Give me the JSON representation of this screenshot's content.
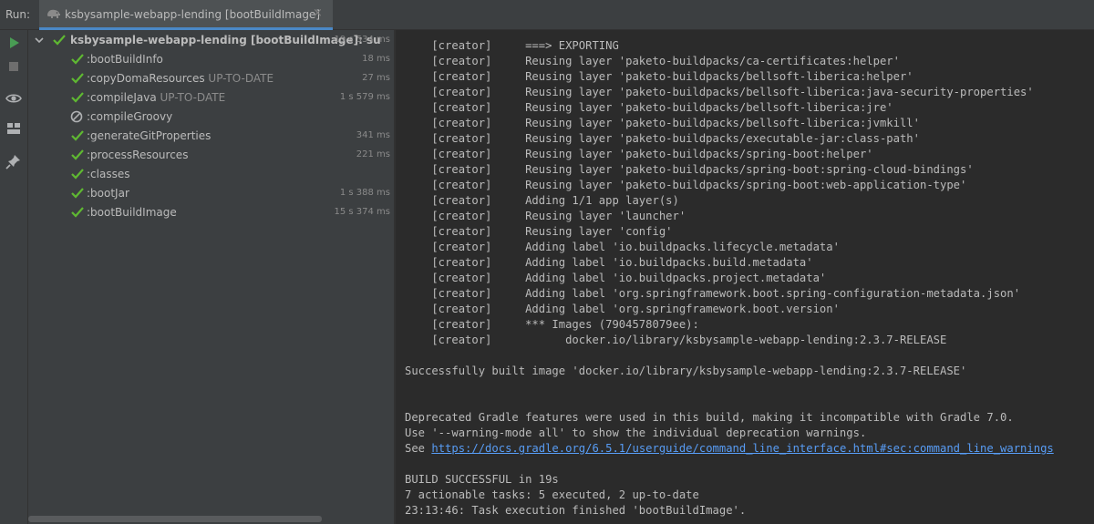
{
  "run_label": "Run:",
  "tab": {
    "title": "ksbysample-webapp-lending [bootBuildImage]",
    "close": "×",
    "icon": "gradle-elephant-icon"
  },
  "toolstrip": [
    {
      "name": "rerun-icon",
      "color": "#499c54"
    },
    {
      "name": "stop-icon",
      "color": "#6e6e6e"
    },
    {
      "name": "eye-icon",
      "color": "#afb1b3"
    },
    {
      "name": "layout-icon",
      "color": "#afb1b3"
    },
    {
      "name": "pin-icon",
      "color": "#afb1b3"
    }
  ],
  "tree": {
    "root": {
      "label": "ksbysample-webapp-lending [bootBuildImage]: su",
      "duration": "19 s 534 ms"
    },
    "tasks": [
      {
        "label": ":bootBuildInfo",
        "suffix": "",
        "duration": "18 ms",
        "status": "success"
      },
      {
        "label": ":copyDomaResources",
        "suffix": " UP-TO-DATE",
        "duration": "27 ms",
        "status": "success"
      },
      {
        "label": ":compileJava",
        "suffix": " UP-TO-DATE",
        "duration": "1 s 579 ms",
        "status": "success"
      },
      {
        "label": ":compileGroovy",
        "suffix": "",
        "duration": "",
        "status": "skipped"
      },
      {
        "label": ":generateGitProperties",
        "suffix": "",
        "duration": "341 ms",
        "status": "success"
      },
      {
        "label": ":processResources",
        "suffix": "",
        "duration": "221 ms",
        "status": "success"
      },
      {
        "label": ":classes",
        "suffix": "",
        "duration": "",
        "status": "success"
      },
      {
        "label": ":bootJar",
        "suffix": "",
        "duration": "1 s 388 ms",
        "status": "success"
      },
      {
        "label": ":bootBuildImage",
        "suffix": "",
        "duration": "15 s 374 ms",
        "status": "success"
      }
    ]
  },
  "colors": {
    "success": "#5fb832",
    "skipped": "#afb1b3",
    "link": "#589df6"
  },
  "console": {
    "lines": [
      "    [creator]     ===> EXPORTING",
      "    [creator]     Reusing layer 'paketo-buildpacks/ca-certificates:helper'",
      "    [creator]     Reusing layer 'paketo-buildpacks/bellsoft-liberica:helper'",
      "    [creator]     Reusing layer 'paketo-buildpacks/bellsoft-liberica:java-security-properties'",
      "    [creator]     Reusing layer 'paketo-buildpacks/bellsoft-liberica:jre'",
      "    [creator]     Reusing layer 'paketo-buildpacks/bellsoft-liberica:jvmkill'",
      "    [creator]     Reusing layer 'paketo-buildpacks/executable-jar:class-path'",
      "    [creator]     Reusing layer 'paketo-buildpacks/spring-boot:helper'",
      "    [creator]     Reusing layer 'paketo-buildpacks/spring-boot:spring-cloud-bindings'",
      "    [creator]     Reusing layer 'paketo-buildpacks/spring-boot:web-application-type'",
      "    [creator]     Adding 1/1 app layer(s)",
      "    [creator]     Reusing layer 'launcher'",
      "    [creator]     Reusing layer 'config'",
      "    [creator]     Adding label 'io.buildpacks.lifecycle.metadata'",
      "    [creator]     Adding label 'io.buildpacks.build.metadata'",
      "    [creator]     Adding label 'io.buildpacks.project.metadata'",
      "    [creator]     Adding label 'org.springframework.boot.spring-configuration-metadata.json'",
      "    [creator]     Adding label 'org.springframework.boot.version'",
      "    [creator]     *** Images (7904578079ee):",
      "    [creator]           docker.io/library/ksbysample-webapp-lending:2.3.7-RELEASE",
      "",
      "Successfully built image 'docker.io/library/ksbysample-webapp-lending:2.3.7-RELEASE'",
      "",
      "",
      "Deprecated Gradle features were used in this build, making it incompatible with Gradle 7.0.",
      "Use '--warning-mode all' to show the individual deprecation warnings.",
      "",
      "",
      "BUILD SUCCESSFUL in 19s",
      "7 actionable tasks: 5 executed, 2 up-to-date",
      "23:13:46: Task execution finished 'bootBuildImage'."
    ],
    "see_prefix": "See ",
    "see_link": "https://docs.gradle.org/6.5.1/userguide/command_line_interface.html#sec:command_line_warnings"
  }
}
